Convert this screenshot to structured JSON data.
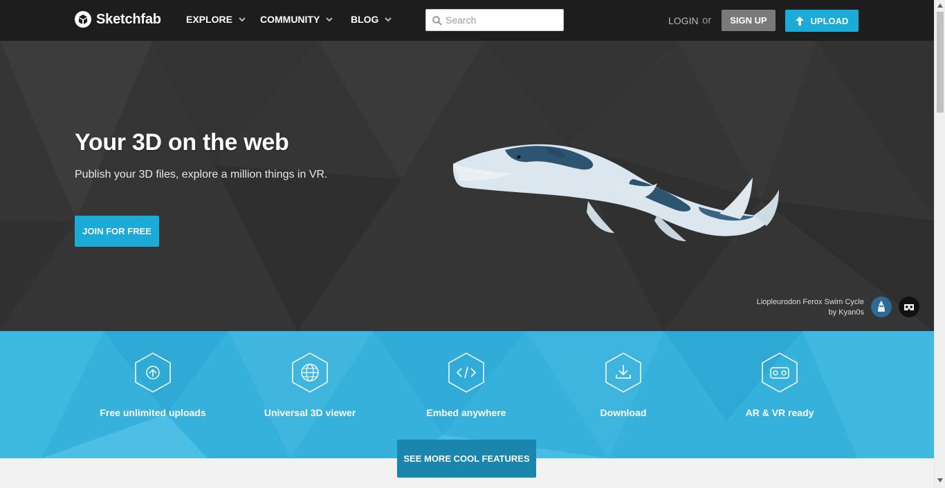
{
  "nav": {
    "brand": "Sketchfab",
    "menu": [
      {
        "label": "EXPLORE"
      },
      {
        "label": "COMMUNITY"
      },
      {
        "label": "BLOG"
      }
    ],
    "search_placeholder": "Search",
    "login": "LOGIN",
    "or": "or",
    "signup": "SIGN UP",
    "upload": "UPLOAD"
  },
  "hero": {
    "title": "Your 3D on the web",
    "subtitle": "Publish your 3D files, explore a million things in VR.",
    "cta": "JOIN FOR FREE",
    "model_title": "Liopleurodon Ferox Swim Cycle",
    "model_author": "by Kyan0s"
  },
  "features": {
    "items": [
      {
        "label": "Free unlimited uploads",
        "icon": "upload-icon"
      },
      {
        "label": "Universal 3D viewer",
        "icon": "globe-icon"
      },
      {
        "label": "Embed anywhere",
        "icon": "code-icon"
      },
      {
        "label": "Download",
        "icon": "download-icon"
      },
      {
        "label": "AR & VR ready",
        "icon": "vr-headset-icon"
      }
    ],
    "cta": "SEE MORE COOL FEATURES"
  },
  "colors": {
    "navbar": "#1d1d1d",
    "accent": "#1caad9",
    "hero_bg": "#353535",
    "features_bg": "#35b1dc",
    "see_more_bg": "#1b86ad"
  }
}
